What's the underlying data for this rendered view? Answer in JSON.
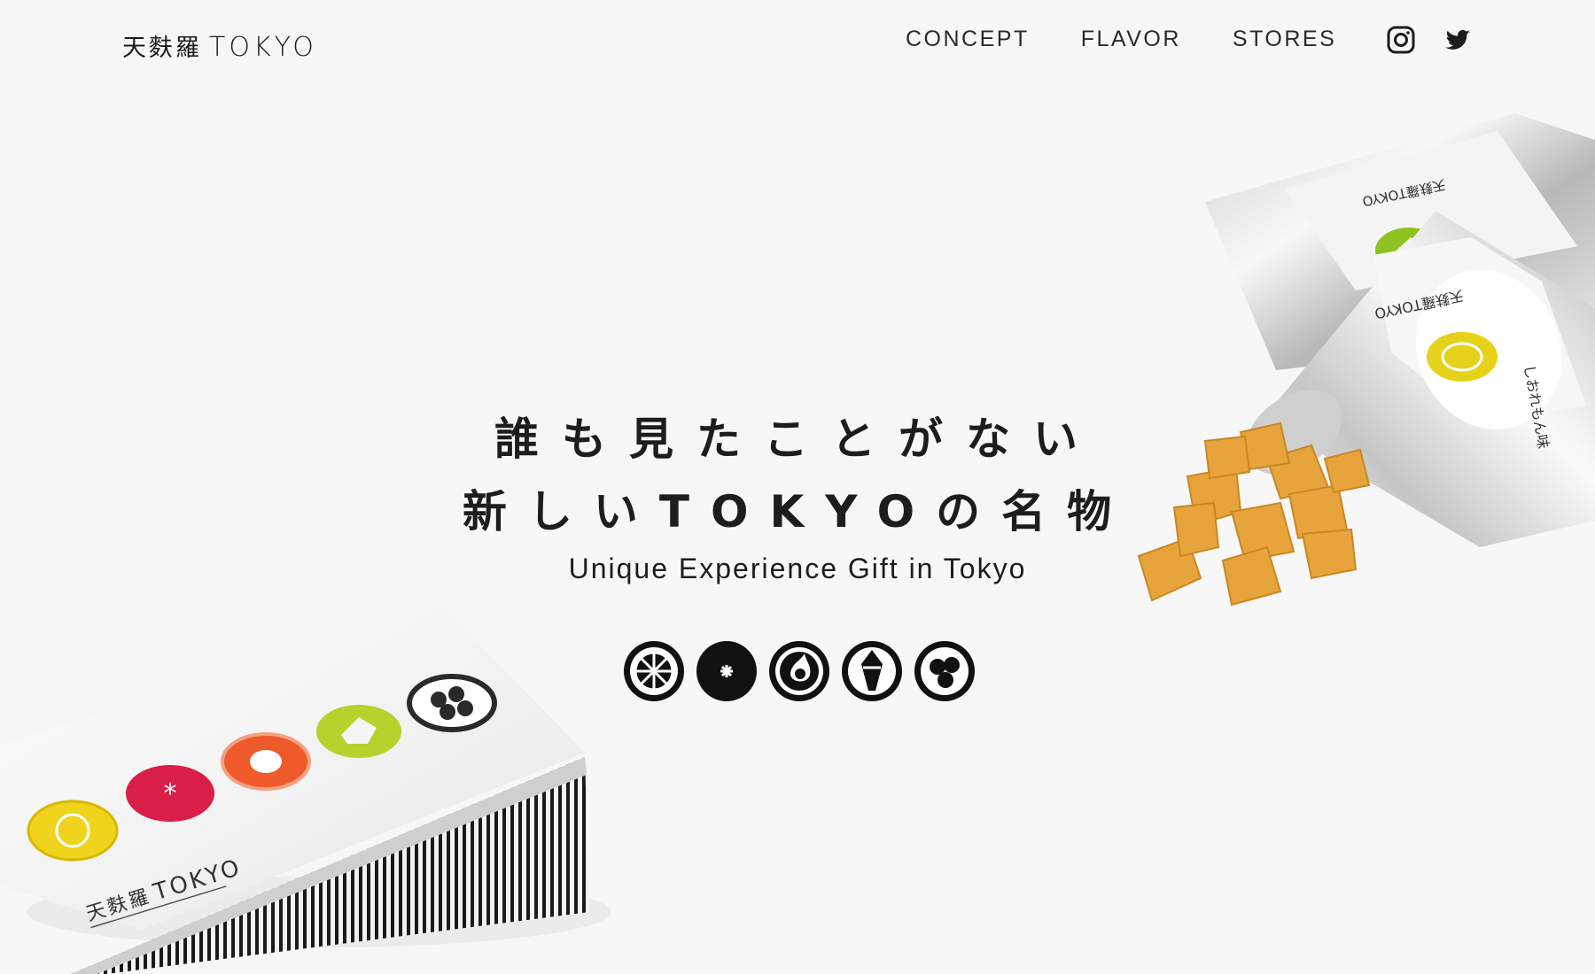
{
  "header": {
    "logo_jp": "天麩羅",
    "logo_en": "TOKYO",
    "nav": [
      "CONCEPT",
      "FLAVOR",
      "STORES"
    ],
    "social": [
      "instagram-icon",
      "twitter-icon"
    ]
  },
  "hero": {
    "headline_line1": "誰も見たことがない",
    "headline_line2": "新しいTOKYOの名物",
    "subtitle": "Unique Experience Gift in Tokyo",
    "flavor_icons": [
      "lemon-icon",
      "star-icon",
      "flame-icon",
      "leaf-icon",
      "triple-circle-icon"
    ]
  },
  "product_labels": {
    "box_brand_jp": "天麩羅",
    "box_brand_en": "TOKYO",
    "bag_brand": "天麩羅TOKYO",
    "bag_flavor_text": "しおれもん味"
  },
  "colors": {
    "background": "#f7f7f7",
    "text": "#1c1c1c",
    "lemon": "#e8d21c",
    "tomato": "#e0204a",
    "chili": "#ee5a2a",
    "matcha": "#a9cc2e",
    "sesame": "#2a2a2a",
    "chip": "#e9a63e"
  }
}
